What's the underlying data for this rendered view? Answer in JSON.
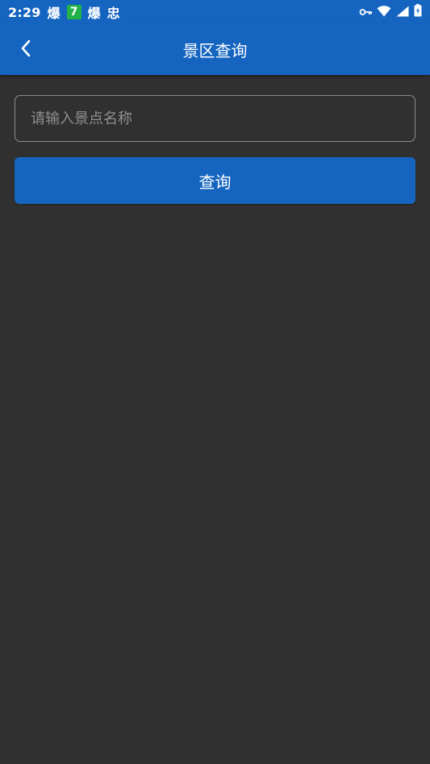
{
  "status_bar": {
    "time": "2:29",
    "app1": "爆",
    "badge": "7",
    "app2": "爆",
    "app3": "忠",
    "icons": [
      "vpn-key-icon",
      "wifi-icon",
      "signal-icon",
      "battery-icon"
    ]
  },
  "app_bar": {
    "title": "景区查询",
    "back_icon": "chevron-left-icon"
  },
  "search": {
    "placeholder": "请输入景点名称",
    "value": ""
  },
  "query_button": {
    "label": "查询"
  },
  "colors": {
    "primary": "#1565c0",
    "background": "#303030",
    "badge_green": "#21b24a"
  }
}
